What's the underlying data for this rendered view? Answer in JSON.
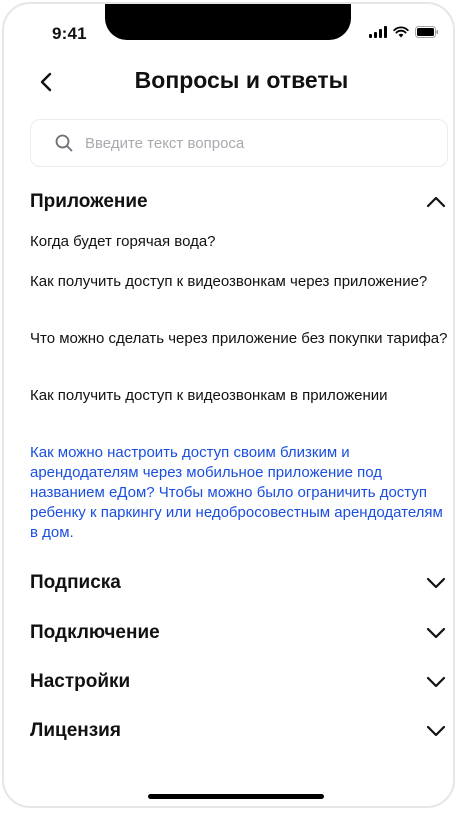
{
  "status_bar": {
    "time": "9:41"
  },
  "header": {
    "title": "Вопросы и ответы"
  },
  "search": {
    "placeholder": "Введите текст вопроса"
  },
  "sections": [
    {
      "title": "Приложение",
      "expanded": true,
      "questions": [
        "Когда будет горячая вода?",
        "Как получить доступ к видеозвонкам через приложение?",
        "Что можно сделать через приложение без покупки тарифа?",
        "Как получить доступ к видеозвонкам в приложении",
        "Как можно настроить доступ своим близким и арендодателям через мобильное приложение под названием еДом? Чтобы можно было ограничить доступ ребенку к паркингу или недобросовестным арендодателям в дом."
      ]
    },
    {
      "title": "Подписка",
      "expanded": false
    },
    {
      "title": "Подключение",
      "expanded": false
    },
    {
      "title": "Настройки",
      "expanded": false
    },
    {
      "title": "Лицензия",
      "expanded": false
    }
  ],
  "colors": {
    "accent": "#1a4fe0",
    "text": "#111111",
    "placeholder": "#a9a9b0"
  },
  "icons": [
    "back-arrow-icon",
    "search-icon",
    "chevron-up-icon",
    "chevron-down-icon"
  ]
}
